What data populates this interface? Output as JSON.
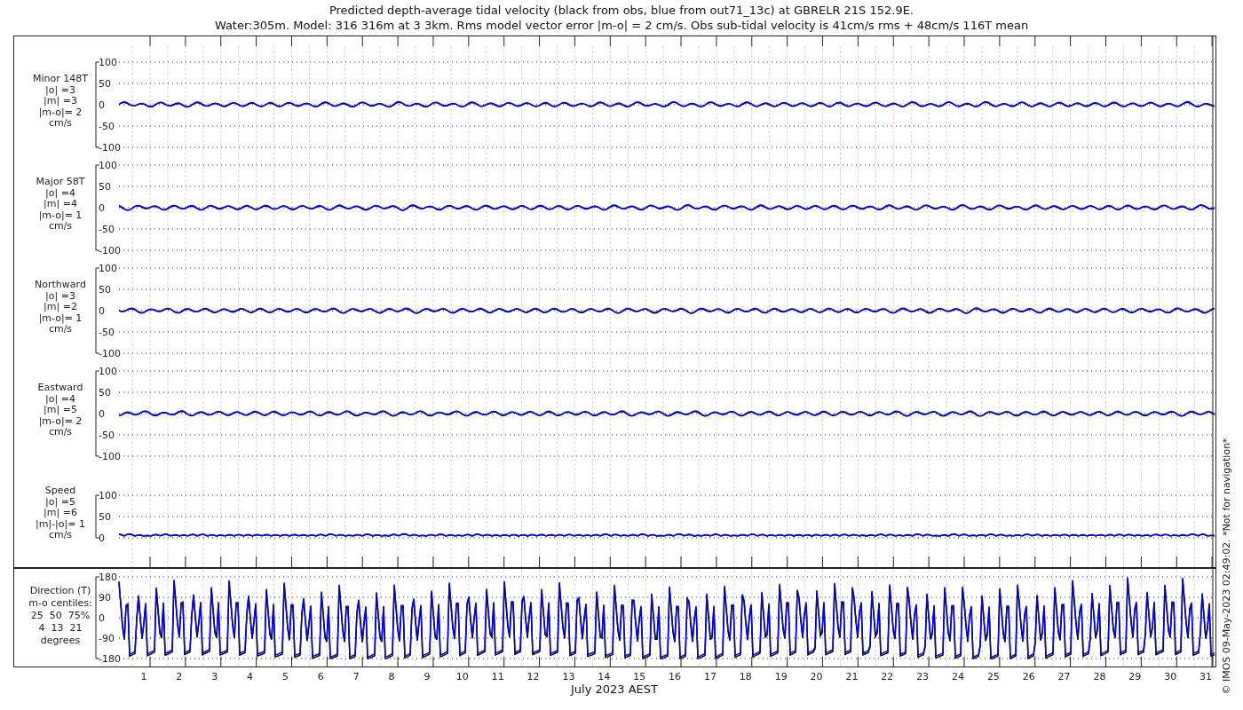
{
  "title_lines": [
    "Predicted depth-average tidal velocity (black from obs, blue from out71_13c) at GBRELR 21S 152.9E.",
    "Water:305m. Model: 316 316m at 3 3km. Rms model vector error |m-o| = 2 cm/s. Obs sub-tidal velocity is 41cm/s rms + 48cm/s 116T mean"
  ],
  "panels": [
    {
      "kind": "velocity",
      "label_lines": [
        "Minor 148T",
        "|o| =3",
        "|m| =3",
        "|m-o|= 2",
        "cm/s"
      ],
      "yticks": [
        "100",
        "50",
        "0",
        "-50",
        "-100"
      ]
    },
    {
      "kind": "velocity",
      "label_lines": [
        "Major 58T",
        "|o| =4",
        "|m| =4",
        "|m-o|= 1",
        "cm/s"
      ],
      "yticks": [
        "100",
        "50",
        "0",
        "-50",
        "-100"
      ]
    },
    {
      "kind": "velocity",
      "label_lines": [
        "Northward",
        "|o| =3",
        "|m| =2",
        "|m-o|= 1",
        "cm/s"
      ],
      "yticks": [
        "100",
        "50",
        "0",
        "-50",
        "-100"
      ]
    },
    {
      "kind": "velocity",
      "label_lines": [
        "Eastward",
        "|o| =4",
        "|m| =5",
        "|m-o|= 2",
        "cm/s"
      ],
      "yticks": [
        "100",
        "50",
        "0",
        "-50",
        "-100"
      ]
    },
    {
      "kind": "speed",
      "label_lines": [
        "Speed",
        "|o| =5",
        "|m| =6",
        "|m|-|o|= 1",
        "cm/s"
      ],
      "yticks": [
        "100",
        "50",
        "0"
      ]
    },
    {
      "kind": "direction",
      "label_lines": [
        "Direction (T)",
        "m-o centiles:",
        "25  50  75%",
        "4  13  21",
        "degrees"
      ],
      "yticks": [
        "180",
        "90",
        "0",
        "-90",
        "-180"
      ]
    }
  ],
  "x_axis": {
    "ticks": [
      "1",
      "2",
      "3",
      "4",
      "5",
      "6",
      "7",
      "8",
      "9",
      "10",
      "11",
      "12",
      "13",
      "14",
      "15",
      "16",
      "17",
      "18",
      "19",
      "20",
      "21",
      "22",
      "23",
      "24",
      "25",
      "26",
      "27",
      "28",
      "29",
      "30",
      "31"
    ],
    "label": "July 2023 AEST"
  },
  "credit": "© IMOS 09-May-2023 02:49:02. *Not for navigation*"
}
